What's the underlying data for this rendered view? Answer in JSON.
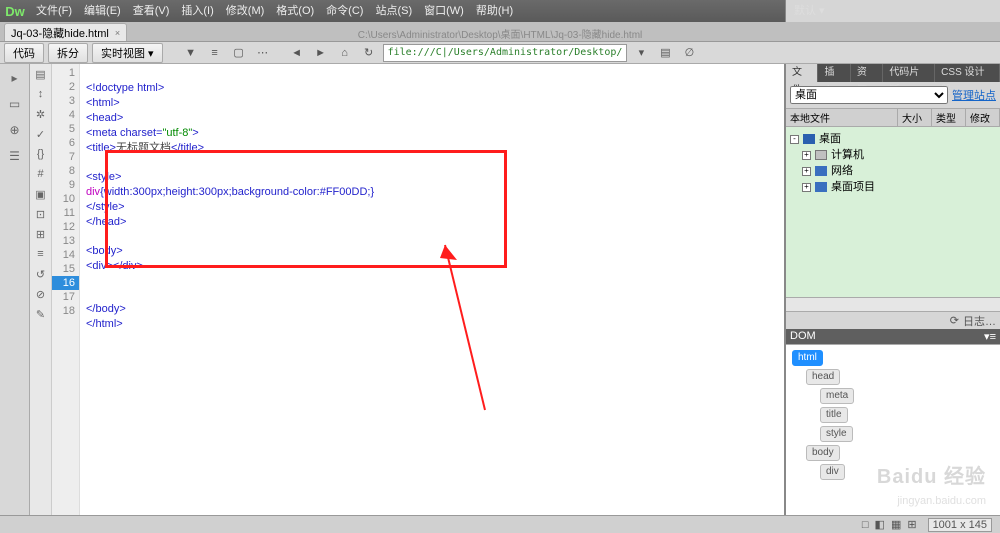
{
  "menu": {
    "items": [
      "文件(F)",
      "编辑(E)",
      "查看(V)",
      "插入(I)",
      "修改(M)",
      "格式(O)",
      "命令(C)",
      "站点(S)",
      "窗口(W)",
      "帮助(H)"
    ],
    "right": "默认 ▾"
  },
  "winbtns": {
    "min": "_",
    "max": "□",
    "close": "×"
  },
  "tab": {
    "name": "Jq-03-隐藏hide.html",
    "close": "×",
    "path": "C:\\Users\\Administrator\\Desktop\\桌面\\HTML\\Jq-03-隐藏hide.html"
  },
  "subbar": {
    "b1": "代码",
    "b2": "拆分",
    "b3": "实时视图 ▾",
    "nav_back": "◄",
    "nav_fwd": "►",
    "home": "⌂",
    "refresh": "↻",
    "addr": "file:///C|/Users/Administrator/Desktop/",
    "drop": "▾",
    "more": "▤",
    "help": "∅"
  },
  "code": {
    "lines": [
      1,
      2,
      3,
      4,
      5,
      6,
      7,
      8,
      9,
      10,
      11,
      12,
      13,
      14,
      15,
      16,
      17,
      18
    ],
    "hl": 16,
    "l1": "<!doctype html>",
    "l2": "<html>",
    "l3": "<head>",
    "l4a": "<meta ",
    "l4b": "charset=",
    "l4c": "\"utf-8\"",
    "l4d": ">",
    "l5a": "<title>",
    "l5b": "无标题文档",
    "l5c": "</title>",
    "l7": "<style>",
    "l8a": "div",
    "l8b": "{",
    "l8c": "width",
    "l8d": ":",
    "l8e": "300px",
    "l8f": ";",
    "l8g": "height",
    "l8h": ":",
    "l8i": "300px",
    "l8j": ";",
    "l8k": "background-color",
    "l8l": ":",
    "l8m": "#FF00DD",
    "l8n": ";}",
    "l9": "</style>",
    "l10": "</head>",
    "l12": "<body>",
    "l13": "<div></div>",
    "l16": "</body>",
    "l17": "</html>"
  },
  "rpanel": {
    "tabs": [
      "文件",
      "插入",
      "资源",
      "代码片断",
      "CSS 设计器"
    ],
    "dropdown": "桌面",
    "manage": "管理站点",
    "cols": [
      "本地文件",
      "大小",
      "类型",
      "修改"
    ],
    "tree": [
      {
        "lvl": 0,
        "pm": "-",
        "ico": "d",
        "label": "桌面"
      },
      {
        "lvl": 1,
        "pm": "+",
        "ico": "c",
        "label": "计算机"
      },
      {
        "lvl": 1,
        "pm": "+",
        "ico": "f",
        "label": "网络"
      },
      {
        "lvl": 1,
        "pm": "+",
        "ico": "f",
        "label": "桌面项目"
      }
    ],
    "log": "日志…",
    "aux1": "⟳",
    "aux2": "C"
  },
  "dom": {
    "title": "DOM",
    "menu": "▾≡",
    "nodes": [
      {
        "lvl": 0,
        "t": "html",
        "sel": true
      },
      {
        "lvl": 1,
        "t": "head"
      },
      {
        "lvl": 2,
        "t": "meta"
      },
      {
        "lvl": 2,
        "t": "title"
      },
      {
        "lvl": 2,
        "t": "style"
      },
      {
        "lvl": 1,
        "t": "body"
      },
      {
        "lvl": 2,
        "t": "div"
      }
    ]
  },
  "status": {
    "icons": [
      "□",
      "◧",
      "▦",
      "⊞"
    ],
    "dims": "1001 x 145"
  },
  "watermark": "Baidu 经验",
  "watermark2": "jingyan.baidu.com"
}
